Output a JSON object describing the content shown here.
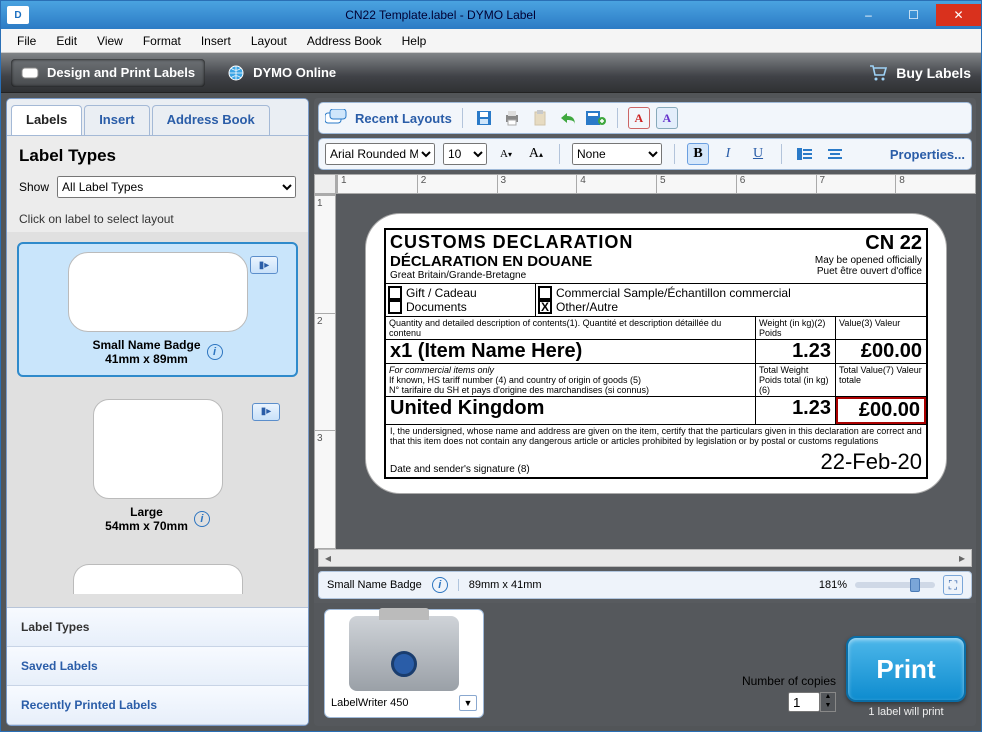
{
  "window": {
    "title": "CN22 Template.label - DYMO Label",
    "min_tip": "Minimize",
    "max_tip": "Maximize",
    "close_tip": "Close"
  },
  "menu": {
    "items": [
      "File",
      "Edit",
      "View",
      "Format",
      "Insert",
      "Layout",
      "Address Book",
      "Help"
    ]
  },
  "ribbon": {
    "design": "Design and Print Labels",
    "online": "DYMO Online",
    "buy": "Buy Labels"
  },
  "left": {
    "tabs": [
      "Labels",
      "Insert",
      "Address Book"
    ],
    "heading": "Label Types",
    "show_label": "Show",
    "show_value": "All Label Types",
    "click_caption": "Click on label to select layout",
    "items": [
      {
        "name": "Small Name Badge",
        "dims": "41mm x 89mm",
        "selected": true
      },
      {
        "name": "Large",
        "dims": "54mm x 70mm",
        "selected": false
      }
    ],
    "sections": [
      "Label Types",
      "Saved Labels",
      "Recently Printed Labels"
    ]
  },
  "toolbar": {
    "recent": "Recent Layouts",
    "font_name": "Arial Rounded MT",
    "font_size": "10",
    "border_style": "None",
    "properties": "Properties...",
    "bold": "B",
    "italic": "I",
    "underline": "U"
  },
  "ruler_h": [
    "1",
    "2",
    "3",
    "4",
    "5",
    "6",
    "7",
    "8"
  ],
  "ruler_v": [
    "1",
    "2",
    "3"
  ],
  "label": {
    "title1": "CUSTOMS DECLARATION",
    "title2": "DÉCLARATION EN DOUANE",
    "country_line": "Great Britain/Grande-Bretagne",
    "cn22": "CN 22",
    "may_open_en": "May be opened officially",
    "may_open_fr": "Puet être ouvert d'office",
    "chk": {
      "gift": "Gift / Cadeau",
      "docs": "Documents",
      "comm": "Commercial Sample/Échantillon commercial",
      "other": "Other/Autre",
      "other_checked": "X"
    },
    "headers": {
      "desc": "Quantity and detailed description of contents(1). Quantité et description détaillée du contenu",
      "weight": "Weight (in kg)(2) Poids",
      "value": "Value(3) Valeur"
    },
    "item_line": "x1 (Item Name Here)",
    "item_weight": "1.23",
    "item_value": "£00.00",
    "commercial_caption": "For commercial items only",
    "commercial_sub1": "If known, HS tariff number (4) and country of origin of goods (5)",
    "commercial_sub2": "N° tarifaire du SH et pays d'origine des marchandises (si connus)",
    "origin_country": "United Kingdom",
    "total_weight_h": "Total Weight Poids total (in kg)(6)",
    "total_value_h": "Total Value(7) Valeur totale",
    "total_weight": "1.23",
    "total_value": "£00.00",
    "declaration": "I, the undersigned, whose name and address are given on the item, certify that the particulars given in this declaration are correct and that this item does not contain any dangerous article or articles prohibited by legislation or by postal or customs regulations",
    "sig_caption": "Date and sender's signature (8)",
    "date": "22-Feb-20"
  },
  "status": {
    "label_name": "Small Name Badge",
    "dims": "89mm x 41mm",
    "zoom": "181%"
  },
  "printer": {
    "name": "LabelWriter 450",
    "copies_label": "Number of copies",
    "copies_value": "1",
    "print": "Print",
    "will_print": "1 label will print"
  }
}
